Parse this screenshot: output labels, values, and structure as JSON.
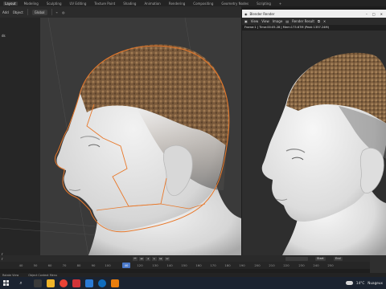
{
  "menu": {
    "tabs": [
      "Layout",
      "Modeling",
      "Sculpting",
      "UV Editing",
      "Texture Paint",
      "Shading",
      "Animation",
      "Rendering",
      "Compositing",
      "Geometry Nodes",
      "Scripting"
    ],
    "active_tab": "Layout",
    "add_tab": "+"
  },
  "header": {
    "add_label": "Add",
    "object_label": "Object",
    "orientation_label": "Global"
  },
  "viewport": {
    "side_label_1": "ds",
    "side_label_2": "r"
  },
  "render_window": {
    "title": "Blender Render",
    "menu": [
      "View",
      "View",
      "Image"
    ],
    "slot_label": "Render Result",
    "frame_info": "Frame:1 | Time:00:05.28 | Mem:173.67M (Peak 1357.24M)"
  },
  "timeline": {
    "current_frame": "40",
    "ruler_ticks": [
      "40",
      "50",
      "60",
      "70",
      "80",
      "90",
      "100",
      "110",
      "120",
      "130",
      "140",
      "150",
      "160",
      "170",
      "180",
      "190",
      "200",
      "210",
      "220",
      "230",
      "240",
      "250"
    ],
    "start_label": "Start",
    "end_label": "End",
    "r_label": "r"
  },
  "statusbar": {
    "left": "Rotate View",
    "middle": "Object Context Menu"
  },
  "taskbar": {
    "weather": "14°C",
    "weather_desc": "Nuageux",
    "search_glyph": "⌕"
  },
  "colors": {
    "selection_outline": "#e8782a",
    "hair_brown": "#7a5a3c",
    "skin": "#e3e3e3",
    "playhead_blue": "#4a78c8",
    "taskbar_bg": "#1b2330"
  }
}
